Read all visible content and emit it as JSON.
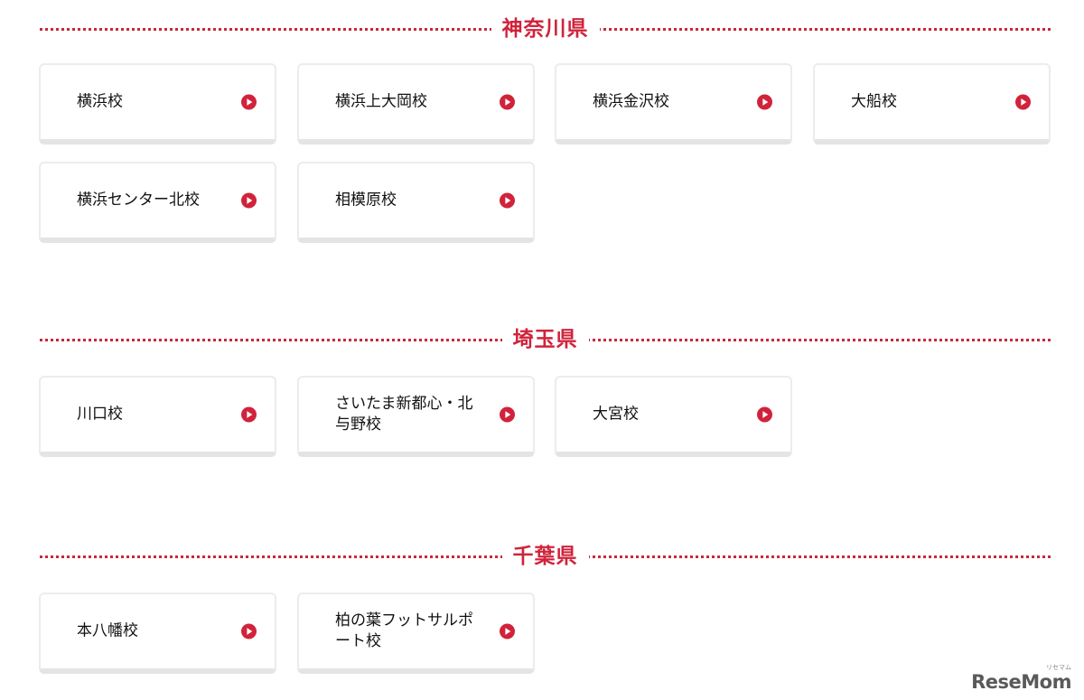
{
  "sections": [
    {
      "title": "神奈川県",
      "schools": [
        "横浜校",
        "横浜上大岡校",
        "横浜金沢校",
        "大船校",
        "横浜センター北校",
        "相模原校"
      ]
    },
    {
      "title": "埼玉県",
      "schools": [
        "川口校",
        "さいたま新都心・北与野校",
        "大宮校"
      ]
    },
    {
      "title": "千葉県",
      "schools": [
        "本八幡校",
        "柏の葉フットサルポート校"
      ]
    }
  ],
  "icon": "play-circle-icon",
  "accent_color": "#d0233b",
  "logo": {
    "text": "ReseMom",
    "kana": "リセマム"
  }
}
